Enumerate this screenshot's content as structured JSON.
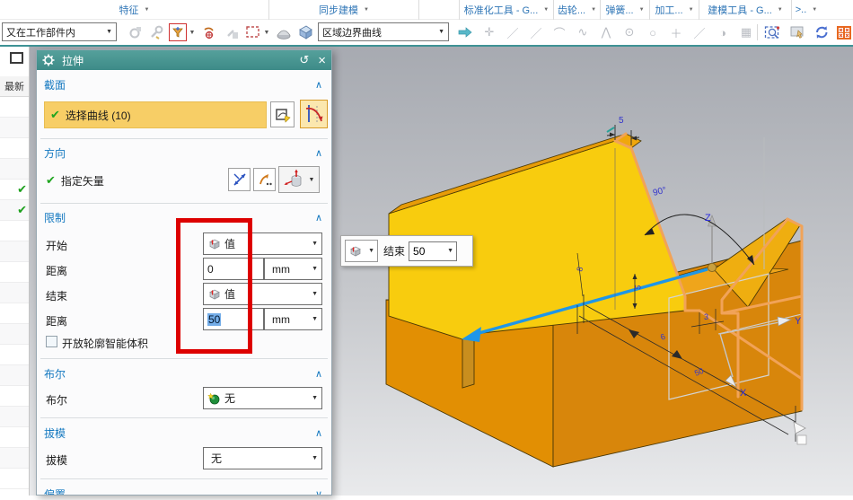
{
  "ribbon": {
    "tabs": [
      {
        "label": "特征"
      },
      {
        "label": "同步建模"
      },
      {
        "label": "标准化工具 - G..."
      },
      {
        "label": "齿轮..."
      },
      {
        "label": "弹簧..."
      },
      {
        "label": "加工..."
      },
      {
        "label": "建模工具 - G..."
      },
      {
        "label": ">.."
      }
    ]
  },
  "toolbar": {
    "scope_dropdown": "又在工作部件内",
    "curve_rule_dropdown": "区域边界曲线",
    "gray_icons": [
      {
        "name": "move-face-icon",
        "glyph": "✛"
      },
      {
        "name": "line-icon",
        "glyph": "／"
      },
      {
        "name": "line2-icon",
        "glyph": "／"
      },
      {
        "name": "arc-icon",
        "glyph": "⌒"
      },
      {
        "name": "spline-icon",
        "glyph": "∿"
      },
      {
        "name": "point-on-curve-icon",
        "glyph": "⋀"
      },
      {
        "name": "circle-center-icon",
        "glyph": "⊙"
      },
      {
        "name": "circle-icon",
        "glyph": "○"
      },
      {
        "name": "point-icon",
        "glyph": "＋"
      },
      {
        "name": "segment-icon",
        "glyph": "／"
      },
      {
        "name": "half-shade-icon",
        "glyph": "◑"
      },
      {
        "name": "grid-icon",
        "glyph": "▦"
      }
    ]
  },
  "navigator": {
    "header": "最新",
    "row_count": 19,
    "checked_rows": [
      4,
      5
    ],
    "check_glyph": "✔"
  },
  "dialog": {
    "title": "拉伸",
    "reset_glyph": "↺",
    "close_glyph": "×",
    "section": {
      "header": "截面",
      "selection": "选择曲线 (10)"
    },
    "direction": {
      "header": "方向",
      "label": "指定矢量"
    },
    "limits": {
      "header": "限制",
      "start_label": "开始",
      "start_type": "值",
      "dist1_label": "距离",
      "dist1_value": "0",
      "dist1_unit": "mm",
      "end_label": "结束",
      "end_type": "值",
      "dist2_label": "距离",
      "dist2_value": "50",
      "dist2_unit": "mm",
      "checkbox_label": "开放轮廓智能体积"
    },
    "boolean": {
      "header": "布尔",
      "label": "布尔",
      "value": "无"
    },
    "draft": {
      "header": "拔模",
      "label": "拔模",
      "value": "无"
    },
    "offset": {
      "header": "偏置"
    },
    "collapse_glyph": "∧",
    "expand_glyph": "∨",
    "check_glyph": "✔",
    "caret_glyph": "▼"
  },
  "floatbar": {
    "label": "结束",
    "value": "50",
    "caret_glyph": "▼"
  },
  "viewport": {
    "dims": {
      "top_width": "5",
      "angle": "90°",
      "left_height": "8",
      "notch_depth": "5",
      "notch_width": "3",
      "groove": "6",
      "length": "50"
    },
    "axes": {
      "x": "X",
      "y": "Y",
      "z": "Z"
    },
    "colors": {
      "face_yellow": "#f8cc0e",
      "face_orange": "#e28f03",
      "face_orange_dark": "#d8860b",
      "profile_orange": "#f1a358",
      "arrow_blue": "#1e96e8",
      "dim_blue": "#3434cc"
    }
  }
}
